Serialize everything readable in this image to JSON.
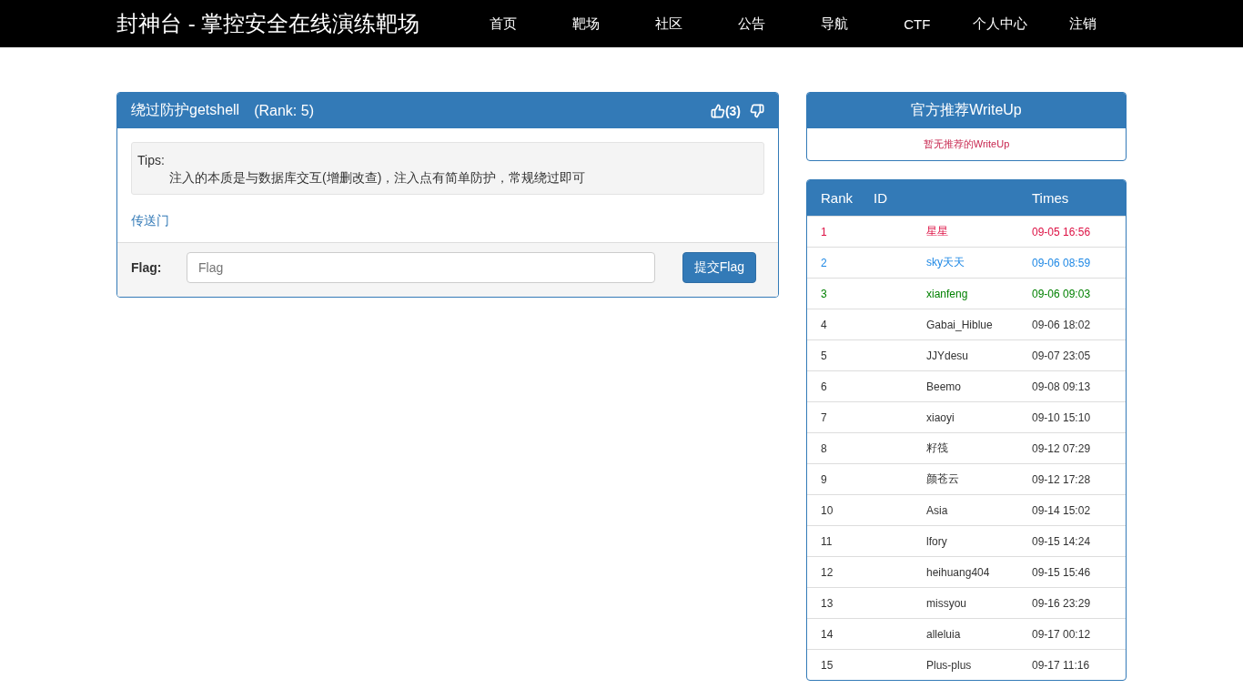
{
  "navbar": {
    "brand": "封神台 - 掌控安全在线演练靶场",
    "links": [
      "首页",
      "靶场",
      "社区",
      "公告",
      "导航",
      "CTF",
      "个人中心",
      "注销"
    ]
  },
  "challenge": {
    "title": "绕过防护getshell",
    "rank": "(Rank: 5)",
    "likes": "(3)",
    "tips_label": "Tips:",
    "tips": "注入的本质是与数据库交互(增删改查)，注入点有简单防护，常规绕过即可",
    "link": "传送门",
    "flag_label": "Flag:",
    "flag_placeholder": "Flag",
    "submit": "提交Flag"
  },
  "writeup": {
    "title": "官方推荐WriteUp",
    "empty": "暂无推荐的WriteUp"
  },
  "ranking": {
    "columns": [
      "Rank",
      "ID",
      "Times"
    ],
    "rows": [
      {
        "rank": "1",
        "id": "星星",
        "time": "09-05 16:56",
        "color": "#dd1144"
      },
      {
        "rank": "2",
        "id": "sky天天",
        "time": "09-06 08:59",
        "color": "#1e88e5"
      },
      {
        "rank": "3",
        "id": "xianfeng",
        "time": "09-06 09:03",
        "color": "#008000"
      },
      {
        "rank": "4",
        "id": "Gabai_Hiblue",
        "time": "09-06 18:02",
        "color": "#333333"
      },
      {
        "rank": "5",
        "id": "JJYdesu",
        "time": "09-07 23:05",
        "color": "#333333"
      },
      {
        "rank": "6",
        "id": "Beemo",
        "time": "09-08 09:13",
        "color": "#333333"
      },
      {
        "rank": "7",
        "id": "xiaoyi",
        "time": "09-10 15:10",
        "color": "#333333"
      },
      {
        "rank": "8",
        "id": "籽筏",
        "time": "09-12 07:29",
        "color": "#333333"
      },
      {
        "rank": "9",
        "id": "颜苍云",
        "time": "09-12 17:28",
        "color": "#333333"
      },
      {
        "rank": "10",
        "id": "Asia",
        "time": "09-14 15:02",
        "color": "#333333"
      },
      {
        "rank": "11",
        "id": "lfory",
        "time": "09-15 14:24",
        "color": "#333333"
      },
      {
        "rank": "12",
        "id": "heihuang404",
        "time": "09-15 15:46",
        "color": "#333333"
      },
      {
        "rank": "13",
        "id": "missyou",
        "time": "09-16 23:29",
        "color": "#333333"
      },
      {
        "rank": "14",
        "id": "alleluia",
        "time": "09-17 00:12",
        "color": "#333333"
      },
      {
        "rank": "15",
        "id": "Plus-plus",
        "time": "09-17 11:16",
        "color": "#333333"
      }
    ]
  }
}
